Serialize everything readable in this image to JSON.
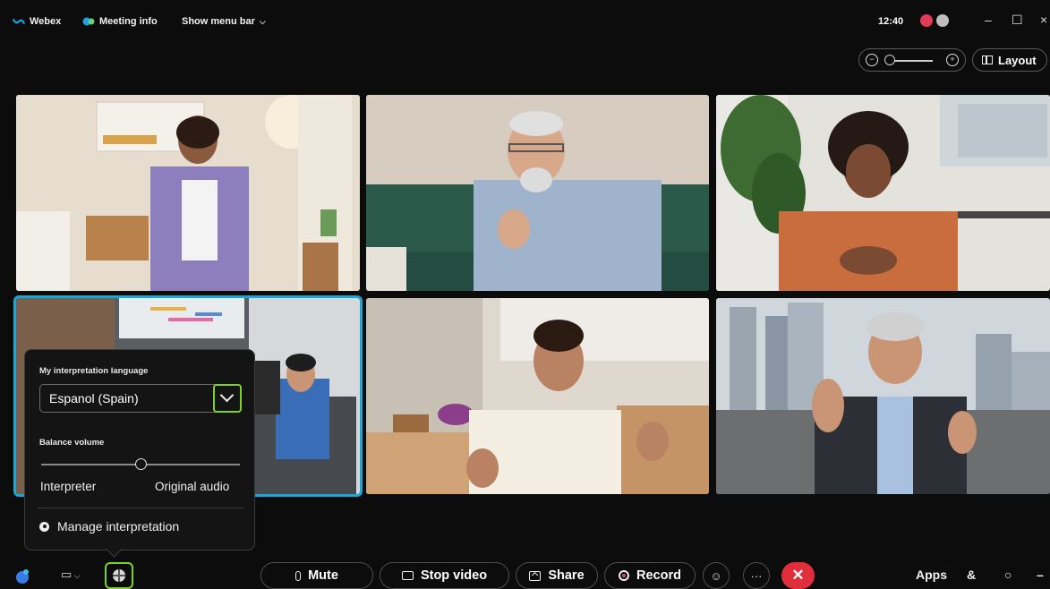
{
  "app": {
    "name": "Webex",
    "brand_color": "#1aa3e0"
  },
  "topbar": {
    "meeting_info": "Meeting info",
    "show_menu_bar": "Show menu bar",
    "time": "12:40",
    "minimize": "–",
    "maximize": "☐",
    "close": "×"
  },
  "view_controls": {
    "layout_label": "Layout"
  },
  "interpretation_popup": {
    "language_label": "My interpretation language",
    "selected_language": "Espanol (Spain)",
    "balance_label": "Balance volume",
    "balance_value": 0.5,
    "left_label": "Interpreter",
    "right_label": "Original audio",
    "manage_label": "Manage interpretation"
  },
  "controls": {
    "mute": "Mute",
    "stop_video": "Stop video",
    "share": "Share",
    "record": "Record",
    "more": "···",
    "end": "✕",
    "apps": "Apps"
  },
  "colors": {
    "accent": "#7ed321",
    "active_speaker": "#18a7d6",
    "end_call": "#e02e3c"
  },
  "participants": [
    {
      "tile": 1,
      "scene": "young woman in lavender jacket, bedroom"
    },
    {
      "tile": 2,
      "scene": "older man with glasses and grey beard"
    },
    {
      "tile": 3,
      "scene": "woman with curly hair, orange blouse, office"
    },
    {
      "tile": 4,
      "scene": "conference room, active speaker"
    },
    {
      "tile": 5,
      "scene": "woman in white blouse, kitchen"
    },
    {
      "tile": 6,
      "scene": "man with headset waving, city skyline"
    }
  ]
}
